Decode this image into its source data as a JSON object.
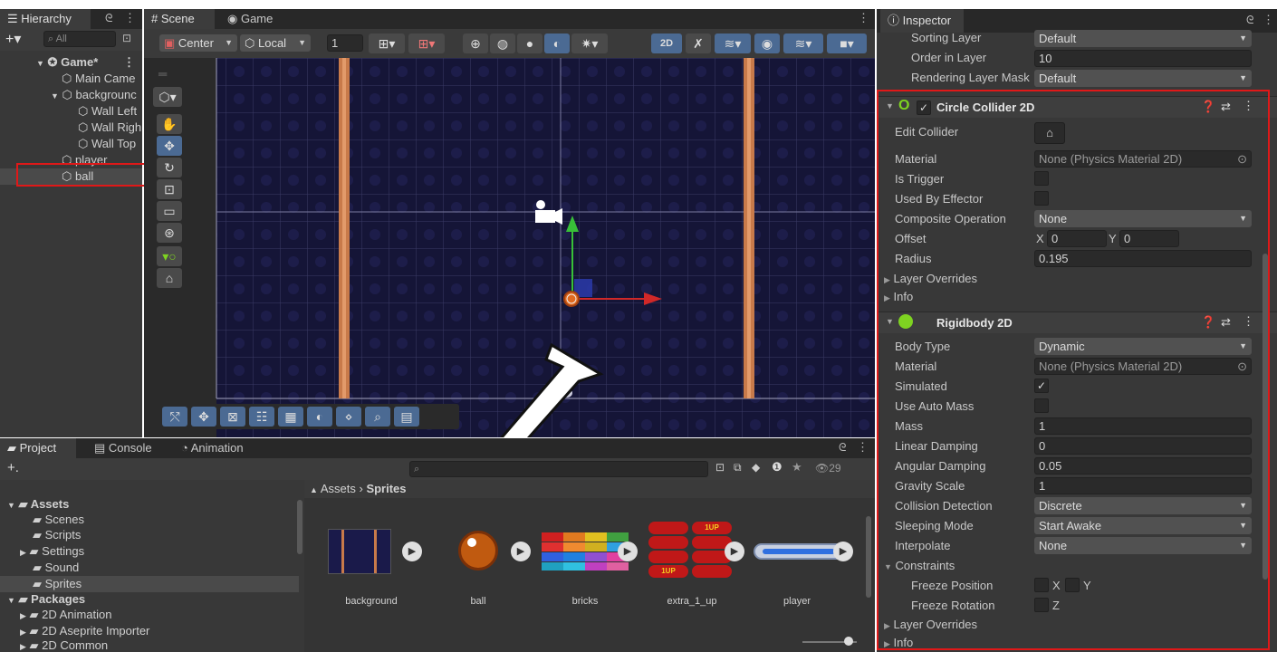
{
  "hierarchy": {
    "tab_label": "Hierarchy",
    "search_placeholder": "All",
    "items": [
      {
        "label": "Game*"
      },
      {
        "label": "Main Came"
      },
      {
        "label": "backgrounc"
      },
      {
        "label": "Wall Left"
      },
      {
        "label": "Wall Righ"
      },
      {
        "label": "Wall Top"
      },
      {
        "label": "player"
      },
      {
        "label": "ball"
      }
    ]
  },
  "scene": {
    "tabs": [
      "Scene",
      "Game"
    ],
    "pivot_label": "Center",
    "space_label": "Local",
    "grid_value": "1",
    "mode_2d": "2D"
  },
  "project": {
    "tabs": [
      "Project",
      "Console",
      "Animation"
    ],
    "count": "29",
    "breadcrumb_root": "Assets",
    "breadcrumb_current": "Sprites",
    "tree": [
      {
        "label": "Assets",
        "bold": true
      },
      {
        "label": "Scenes"
      },
      {
        "label": "Scripts"
      },
      {
        "label": "Settings"
      },
      {
        "label": "Sound"
      },
      {
        "label": "Sprites"
      },
      {
        "label": "Packages",
        "bold": true
      },
      {
        "label": "2D Animation"
      },
      {
        "label": "2D Aseprite Importer"
      },
      {
        "label": "2D Common"
      }
    ],
    "assets": [
      "background",
      "ball",
      "bricks",
      "extra_1_up",
      "player"
    ],
    "extra_label": "1UP"
  },
  "inspector": {
    "tab_label": "Inspector",
    "top": {
      "sorting_layer_label": "Sorting Layer",
      "sorting_layer_value": "Default",
      "order_label": "Order in Layer",
      "order_value": "10",
      "rendering_label": "Rendering Layer Mask",
      "rendering_value": "Default"
    },
    "circle": {
      "title": "Circle Collider 2D",
      "edit_collider": "Edit Collider",
      "material_label": "Material",
      "material_value": "None (Physics Material 2D)",
      "is_trigger": "Is Trigger",
      "used_by_effector": "Used By Effector",
      "composite_label": "Composite Operation",
      "composite_value": "None",
      "offset_label": "Offset",
      "offset_x_label": "X",
      "offset_x": "0",
      "offset_y_label": "Y",
      "offset_y": "0",
      "radius_label": "Radius",
      "radius_value": "0.195",
      "layer_overrides": "Layer Overrides",
      "info": "Info"
    },
    "rigidbody": {
      "title": "Rigidbody 2D",
      "body_type_label": "Body Type",
      "body_type_value": "Dynamic",
      "material_label": "Material",
      "material_value": "None (Physics Material 2D)",
      "simulated": "Simulated",
      "use_auto_mass": "Use Auto Mass",
      "mass_label": "Mass",
      "mass_value": "1",
      "linear_label": "Linear Damping",
      "linear_value": "0",
      "angular_label": "Angular Damping",
      "angular_value": "0.05",
      "gravity_label": "Gravity Scale",
      "gravity_value": "1",
      "collision_label": "Collision Detection",
      "collision_value": "Discrete",
      "sleeping_label": "Sleeping Mode",
      "sleeping_value": "Start Awake",
      "interpolate_label": "Interpolate",
      "interpolate_value": "None",
      "constraints": "Constraints",
      "freeze_pos": "Freeze Position",
      "freeze_pos_x": "X",
      "freeze_pos_y": "Y",
      "freeze_rot": "Freeze Rotation",
      "freeze_rot_z": "Z",
      "layer_overrides": "Layer Overrides",
      "info": "Info"
    }
  },
  "colors": {
    "highlight_red": "#e01818",
    "scene_bg": "#141436",
    "accent_blue": "#4b6a93",
    "collider_green": "#7ed321"
  }
}
